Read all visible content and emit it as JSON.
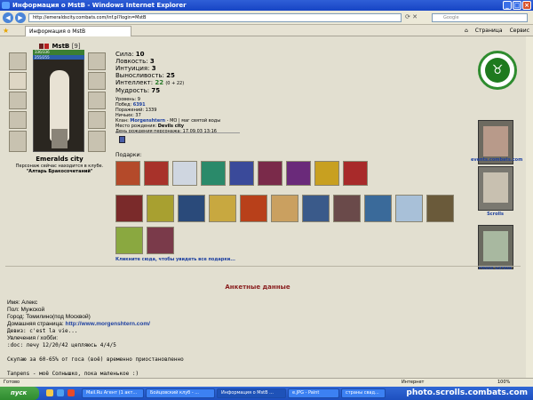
{
  "window": {
    "title": "Информация о MstB - Windows Internet Explorer"
  },
  "address": {
    "url": "http://emeraldscity.combats.com/inf.pl?login=MstB",
    "search_placeholder": "Google"
  },
  "tabs": {
    "active": "Информация о MstB",
    "tools": [
      "Страница",
      "Сервис"
    ]
  },
  "character": {
    "name": "MstB",
    "level": "[9]",
    "hp": "336/336",
    "mana": "255/255",
    "city": "Emeralds city",
    "location_note": "Персонаж сейчас находится в клубе.",
    "location": "\"Алтарь Бракосочетаний\""
  },
  "stats": [
    {
      "label": "Сила:",
      "value": "10"
    },
    {
      "label": "Ловкость:",
      "value": "3"
    },
    {
      "label": "Интуиция:",
      "value": "3"
    },
    {
      "label": "Выносливость:",
      "value": "25"
    },
    {
      "label": "Интеллект:",
      "value": "22",
      "extra": "(0 + 22)"
    },
    {
      "label": "Мудрость:",
      "value": "75"
    }
  ],
  "info": {
    "level_line": "Уровень: 9",
    "wins_label": "Побед:",
    "wins": "6391",
    "losses_line": "Поражений: 1339",
    "draws_line": "Ничьих: 37",
    "clan_label": "Клан:",
    "clan_name": "Morgenshtern",
    "clan_rest": "- МО | маг святой воды",
    "birthplace_label": "Место рождения:",
    "birthplace": "Devils city",
    "birthday_line": "День рождения персонажа: 17.09.03 13:16"
  },
  "gifts": {
    "label": "Подарки:",
    "more_link": "Кликните сюда, чтобы увидеть все подарки...",
    "row1_colors": [
      "#b44a2a",
      "#a8322a",
      "#cfd6e0",
      "#2a8a6a",
      "#3a4a9a",
      "#7a2a4a",
      "#6a2a7a",
      "#c8a020",
      "#a82a2a"
    ],
    "row2_colors": [
      "#7a2a2a",
      "#a8a030",
      "#2a4a7a",
      "#c8a840",
      "#b8401a",
      "#caa060",
      "#3a5a8a",
      "#6a4a4a",
      "#3a6a9a",
      "#a8c0d8",
      "#6a5a3a"
    ],
    "row3_colors": [
      "#8aa840",
      "#7a3a4a"
    ]
  },
  "side": {
    "events": "events.combats.com",
    "scrolls": "Scrolls",
    "photo_scrolls": "Photo Scrolls"
  },
  "profile": {
    "section_title": "Анкетные данные",
    "name_line": "Имя: Алекс",
    "sex_line": "Пол: Мужской",
    "city_line": "Город: Томилино(под Москвой)",
    "homepage_label": "Домашняя страница:",
    "homepage": "http://www.morgenshtern.com/",
    "motto_line": "Девиз: c'est la vie...",
    "hobby_label": "Увлечения / хобби:",
    "line1": ":doc: лечу 12/20/42 цепляюсь 4/4/5",
    "line2": "Скупаю за 60-65% от госа (воё) временно приостановленно",
    "line3": "Tanpens - моё Солнышко, пока маленькое :)"
  },
  "status": {
    "left": "Готово",
    "zone": "Интернет",
    "zoom": "100%"
  },
  "taskbar": {
    "start": "пуск",
    "buttons": [
      "Mail.Ru Агент (1 акт...",
      "Бойцовский клуб - ...",
      "Информация о MstB ...",
      "e.JPG - Paint",
      "страны свад..."
    ],
    "watermark": "photo.scrolls.combats.com"
  }
}
